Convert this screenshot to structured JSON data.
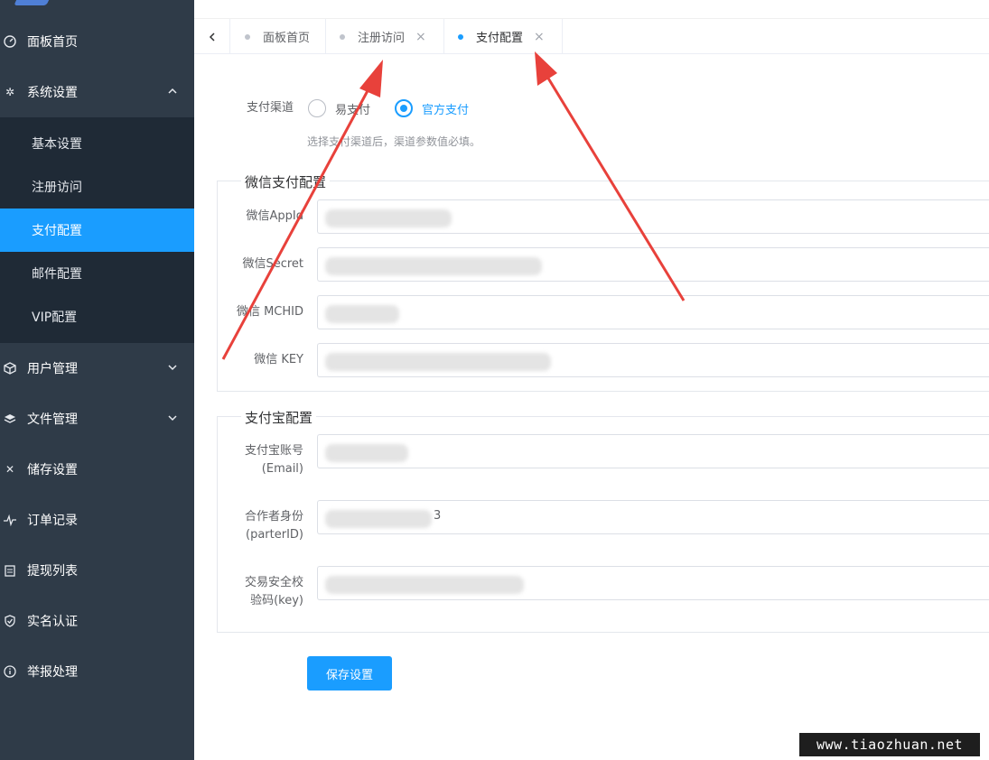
{
  "sidebar": {
    "items": [
      {
        "label": "面板首页",
        "icon": "dashboard-icon"
      },
      {
        "label": "系统设置",
        "icon": "gear-icon"
      },
      {
        "label": "用户管理",
        "icon": "cube-icon"
      },
      {
        "label": "文件管理",
        "icon": "layers-icon"
      },
      {
        "label": "储存设置",
        "icon": "tools-icon"
      },
      {
        "label": "订单记录",
        "icon": "pulse-icon"
      },
      {
        "label": "提现列表",
        "icon": "clipboard-icon"
      },
      {
        "label": "实名认证",
        "icon": "shield-icon"
      },
      {
        "label": "举报处理",
        "icon": "info-icon"
      }
    ],
    "submenu": [
      {
        "label": "基本设置"
      },
      {
        "label": "注册访问"
      },
      {
        "label": "支付配置"
      },
      {
        "label": "邮件配置"
      },
      {
        "label": "VIP配置"
      }
    ]
  },
  "tabs": [
    {
      "label": "面板首页"
    },
    {
      "label": "注册访问"
    },
    {
      "label": "支付配置"
    }
  ],
  "channel": {
    "label": "支付渠道",
    "options": [
      "易支付",
      "官方支付"
    ],
    "selected": "官方支付",
    "hint": "选择支付渠道后，渠道参数值必填。"
  },
  "wechat": {
    "legend": "微信支付配置",
    "appid_label": "微信AppId",
    "secret_label": "微信Secret",
    "mchid_label": "微信 MCHID",
    "key_label": "微信 KEY"
  },
  "alipay": {
    "legend": "支付宝配置",
    "account_label_1": "支付宝账号",
    "account_label_2": "(Email)",
    "partner_label_1": "合作者身份",
    "partner_label_2": "(parterID)",
    "partner_visible_suffix": "3",
    "key_label_1": "交易安全校",
    "key_label_2": "验码(key)"
  },
  "save_label": "保存设置",
  "watermark": "www.tiaozhuan.net",
  "colors": {
    "sidebar": "#2f3b48",
    "submenu": "#1f2a36",
    "accent": "#1a9dff",
    "arrow": "#e8413b"
  }
}
